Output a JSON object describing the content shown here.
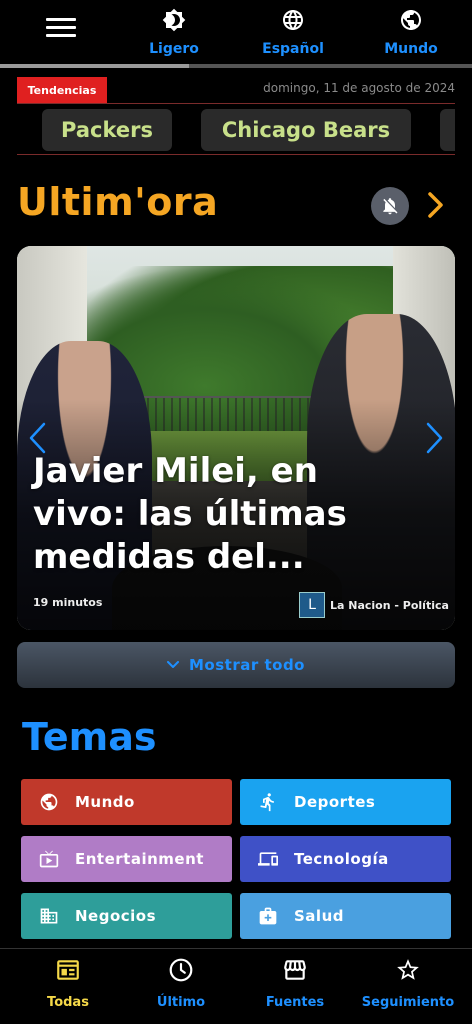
{
  "topbar": {
    "items": [
      {
        "label": "Ligero",
        "icon": "brightness-icon"
      },
      {
        "label": "Español",
        "icon": "globe-language-icon"
      },
      {
        "label": "Mundo",
        "icon": "globe-region-icon"
      }
    ],
    "reading_progress": 0.4
  },
  "trending": {
    "badge": "Tendencias",
    "date": "domingo, 11 de agosto de 2024",
    "chips": [
      "Packers",
      "Chicago Bears"
    ]
  },
  "latest": {
    "title": "Ultim'ora",
    "card": {
      "headline": "Javier Milei, en vivo: las últimas medidas del...",
      "time": "19 minutos",
      "source_initial": "L",
      "source": "La Nacion - Política"
    },
    "show_all": "Mostrar todo"
  },
  "topics": {
    "title": "Temas",
    "items": [
      {
        "label": "Mundo",
        "icon": "globe-icon",
        "color": "#c0392b"
      },
      {
        "label": "Deportes",
        "icon": "running-icon",
        "color": "#1aa3f0"
      },
      {
        "label": "Entertainment",
        "icon": "tv-icon",
        "color": "#b07cc6"
      },
      {
        "label": "Tecnología",
        "icon": "devices-icon",
        "color": "#3f51c7"
      },
      {
        "label": "Negocios",
        "icon": "business-icon",
        "color": "#2e9e9a"
      },
      {
        "label": "Salud",
        "icon": "medical-bag-icon",
        "color": "#4aa0e0"
      }
    ]
  },
  "bottom_nav": {
    "items": [
      {
        "label": "Todas",
        "icon": "newspaper-icon",
        "color": "#f5d949",
        "active": true
      },
      {
        "label": "Último",
        "icon": "clock-icon",
        "color": "#1e90ff"
      },
      {
        "label": "Fuentes",
        "icon": "storefront-icon",
        "color": "#1e90ff"
      },
      {
        "label": "Seguimiento",
        "icon": "star-icon",
        "color": "#1e90ff"
      }
    ]
  }
}
